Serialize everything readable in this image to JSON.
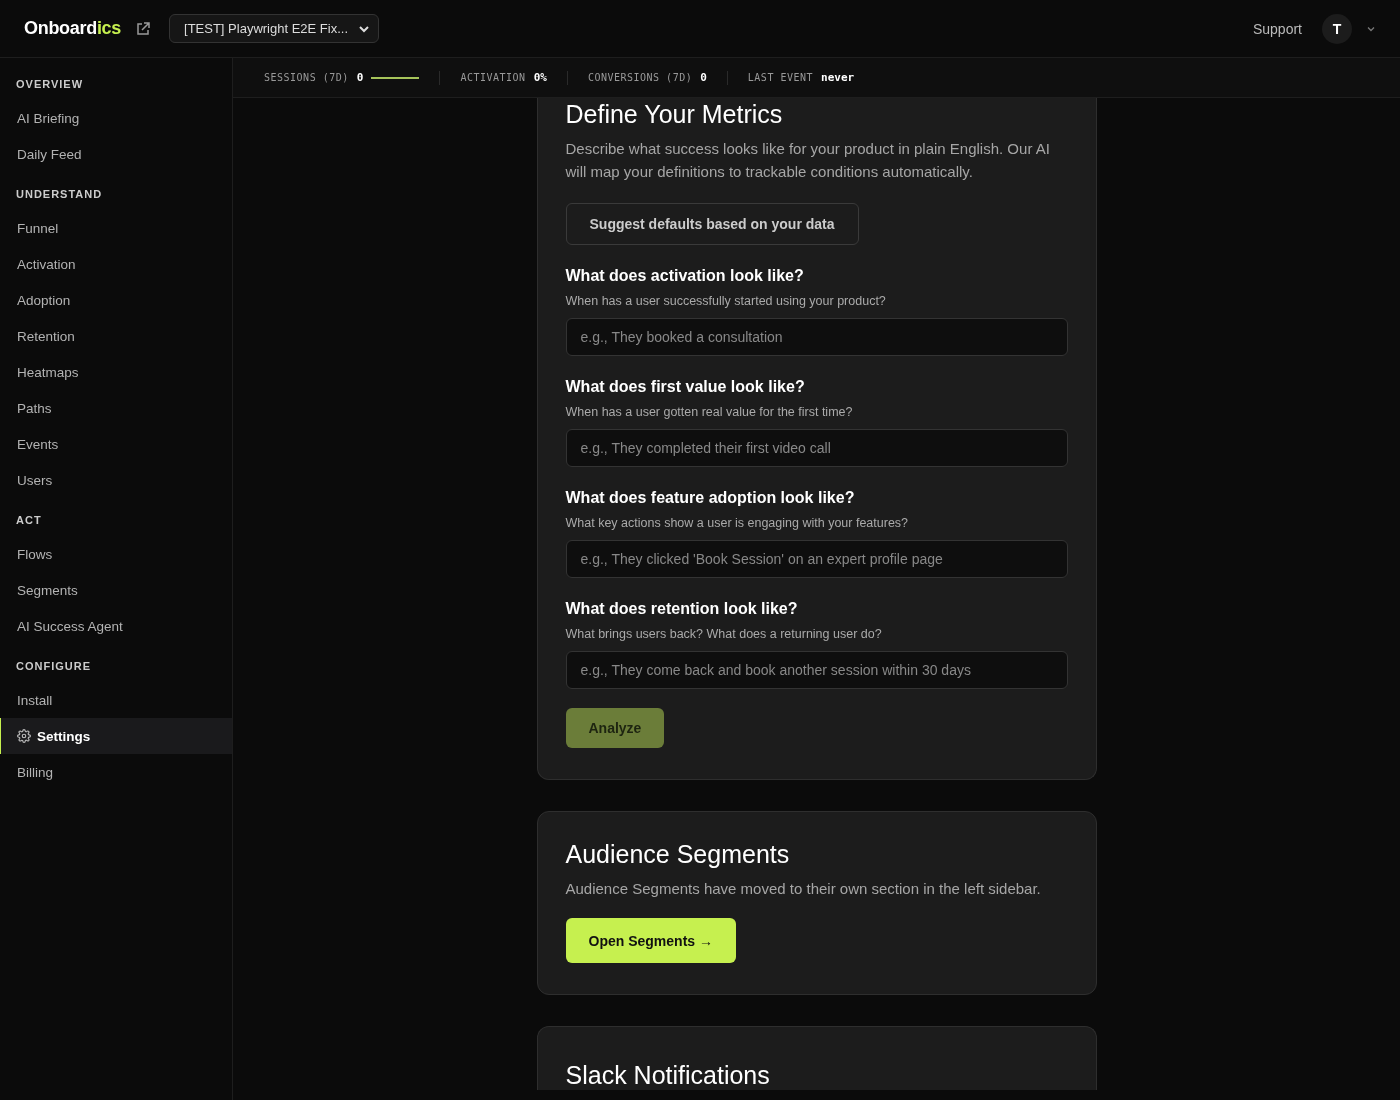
{
  "header": {
    "logo_main": "Onboard",
    "logo_accent": "ics",
    "project_select": "[TEST] Playwright E2E Fix...",
    "support": "Support",
    "avatar": "T"
  },
  "sidebar": {
    "sections": [
      {
        "title": "OVERVIEW",
        "items": [
          {
            "label": "AI Briefing",
            "selected": false,
            "icon": false
          },
          {
            "label": "Daily Feed",
            "selected": false,
            "icon": false
          }
        ]
      },
      {
        "title": "UNDERSTAND",
        "items": [
          {
            "label": "Funnel",
            "selected": false,
            "icon": false
          },
          {
            "label": "Activation",
            "selected": false,
            "icon": false
          },
          {
            "label": "Adoption",
            "selected": false,
            "icon": false
          },
          {
            "label": "Retention",
            "selected": false,
            "icon": false
          },
          {
            "label": "Heatmaps",
            "selected": false,
            "icon": false
          },
          {
            "label": "Paths",
            "selected": false,
            "icon": false
          },
          {
            "label": "Events",
            "selected": false,
            "icon": false
          },
          {
            "label": "Users",
            "selected": false,
            "icon": false
          }
        ]
      },
      {
        "title": "ACT",
        "items": [
          {
            "label": "Flows",
            "selected": false,
            "icon": false
          },
          {
            "label": "Segments",
            "selected": false,
            "icon": false
          },
          {
            "label": "AI Success Agent",
            "selected": false,
            "icon": false
          }
        ]
      },
      {
        "title": "CONFIGURE",
        "items": [
          {
            "label": "Install",
            "selected": false,
            "icon": false
          },
          {
            "label": "Settings",
            "selected": true,
            "icon": true
          },
          {
            "label": "Billing",
            "selected": false,
            "icon": false
          }
        ]
      }
    ]
  },
  "stats": [
    {
      "label": "SESSIONS (7D)",
      "value": "0",
      "sparkline": true
    },
    {
      "label": "ACTIVATION",
      "value": "0%",
      "sparkline": false
    },
    {
      "label": "CONVERSIONS (7D)",
      "value": "0",
      "sparkline": false
    },
    {
      "label": "LAST EVENT",
      "value": "never",
      "sparkline": false
    }
  ],
  "metrics_card": {
    "title": "Define Your Metrics",
    "description": "Describe what success looks like for your product in plain English. Our AI will map your definitions to trackable conditions automatically.",
    "suggest_button": "Suggest defaults based on your data",
    "questions": [
      {
        "label": "What does activation look like?",
        "hint": "When has a user successfully started using your product?",
        "placeholder": "e.g., They booked a consultation"
      },
      {
        "label": "What does first value look like?",
        "hint": "When has a user gotten real value for the first time?",
        "placeholder": "e.g., They completed their first video call"
      },
      {
        "label": "What does feature adoption look like?",
        "hint": "What key actions show a user is engaging with your features?",
        "placeholder": "e.g., They clicked 'Book Session' on an expert profile page"
      },
      {
        "label": "What does retention look like?",
        "hint": "What brings users back? What does a returning user do?",
        "placeholder": "e.g., They come back and book another session within 30 days"
      }
    ],
    "analyze_button": {
      "label": "Analyze",
      "disabled": true
    }
  },
  "segments_card": {
    "title": "Audience Segments",
    "description": "Audience Segments have moved to their own section in the left sidebar.",
    "button": "Open Segments →"
  },
  "slack_card": {
    "title": "Slack Notifications"
  }
}
